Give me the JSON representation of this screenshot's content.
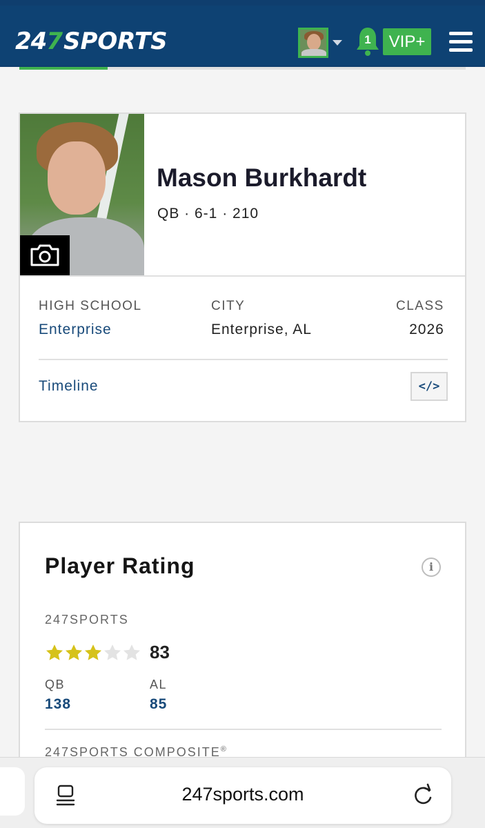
{
  "header": {
    "logo_num": "24",
    "logo_seven": "7",
    "logo_word": "SPORTS",
    "notification_count": "1",
    "vip_label": "VIP+"
  },
  "profile": {
    "name": "Mason Burkhardt",
    "meta": "QB · 6-1 · 210",
    "high_school_label": "HIGH SCHOOL",
    "high_school": "Enterprise",
    "city_label": "CITY",
    "city": "Enterprise, AL",
    "class_label": "CLASS",
    "class_year": "2026",
    "timeline_label": "Timeline",
    "embed_label": "</>"
  },
  "rating": {
    "title": "Player Rating",
    "info_glyph": "i",
    "source_label": "247SPORTS",
    "stars_filled": 3,
    "stars_total": 5,
    "score": "83",
    "position_label": "QB",
    "position_rank": "138",
    "state_label": "AL",
    "state_rank": "85",
    "composite_label": "247SPORTS COMPOSITE",
    "composite_mark": "®"
  },
  "browser": {
    "url": "247sports.com"
  },
  "colors": {
    "header_bg": "#0e4273",
    "accent_green": "#3fb34f",
    "link_blue": "#184a7a",
    "star_gold": "#d6c21a",
    "star_empty": "#e3e3e3"
  }
}
